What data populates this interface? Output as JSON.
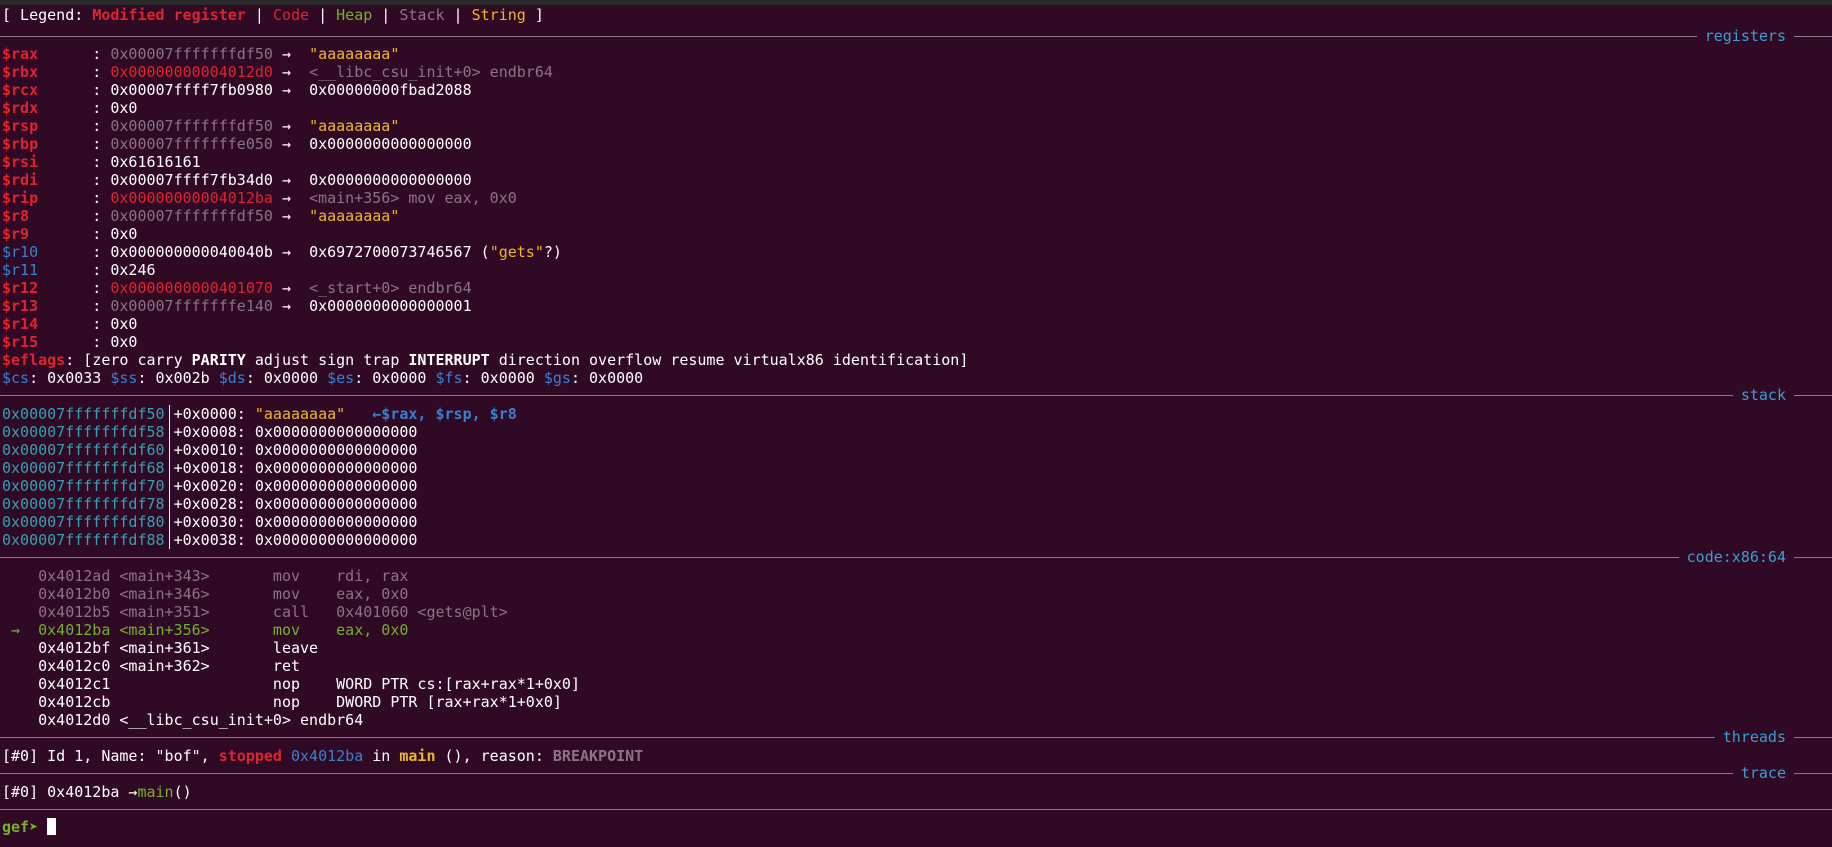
{
  "legend": {
    "open": "[ Legend: ",
    "modified": "Modified register",
    "sep": " | ",
    "code": "Code",
    "heap": "Heap",
    "stack": "Stack",
    "string": "String",
    "close": " ]"
  },
  "sections": {
    "registers": "registers",
    "stack": "stack",
    "code": "code:x86:64",
    "threads": "threads",
    "trace": "trace"
  },
  "arrow": " →  ",
  "registers": [
    {
      "name": "$rax   ",
      "value": "0x00007fffffffdf50",
      "deref": "\"aaaaaaaa\""
    },
    {
      "name": "$rbx   ",
      "value": "0x00000000004012d0",
      "deref": "<__libc_csu_init+0> endbr64"
    },
    {
      "name": "$rcx   ",
      "value": "0x00007ffff7fb0980",
      "deref": "0x00000000fbad2088"
    },
    {
      "name": "$rdx   ",
      "value": "0x0",
      "deref": ""
    },
    {
      "name": "$rsp   ",
      "value": "0x00007fffffffdf50",
      "deref": "\"aaaaaaaa\""
    },
    {
      "name": "$rbp   ",
      "value": "0x00007fffffffe050",
      "deref": "0x0000000000000000"
    },
    {
      "name": "$rsi   ",
      "value": "0x61616161",
      "deref": ""
    },
    {
      "name": "$rdi   ",
      "value": "0x00007ffff7fb34d0",
      "deref": "0x0000000000000000"
    },
    {
      "name": "$rip   ",
      "value": "0x00000000004012ba",
      "deref": "<main+356> mov eax, 0x0"
    },
    {
      "name": "$r8    ",
      "value": "0x00007fffffffdf50",
      "deref": "\"aaaaaaaa\""
    },
    {
      "name": "$r9    ",
      "value": "0x0",
      "deref": ""
    },
    {
      "name": "$r10   ",
      "value": "0x000000000040040b",
      "deref": "0x6972700073746567 (",
      "deref_str": "\"gets\"",
      "deref_tail": "?)"
    },
    {
      "name": "$r11   ",
      "value": "0x246",
      "deref": ""
    },
    {
      "name": "$r12   ",
      "value": "0x0000000000401070",
      "deref": "<_start+0> endbr64"
    },
    {
      "name": "$r13   ",
      "value": "0x00007fffffffe140",
      "deref": "0x0000000000000001"
    },
    {
      "name": "$r14   ",
      "value": "0x0",
      "deref": ""
    },
    {
      "name": "$r15   ",
      "value": "0x0",
      "deref": ""
    }
  ],
  "eflags": {
    "name": "$eflags",
    "open": ": [",
    "zero": "zero",
    "carry": "carry",
    "parity": "PARITY",
    "adjust": "adjust",
    "sign": "sign",
    "trap": "trap",
    "interrupt": "INTERRUPT",
    "direction": "direction",
    "overflow": "overflow",
    "resume": "resume",
    "virtualx86": "virtualx86",
    "identification": "identification",
    "close": "]"
  },
  "segments": {
    "cs": "$cs",
    "cs_v": ": 0x0033 ",
    "ss": "$ss",
    "ss_v": ": 0x002b ",
    "ds": "$ds",
    "ds_v": ": 0x0000 ",
    "es": "$es",
    "es_v": ": 0x0000 ",
    "fs": "$fs",
    "fs_v": ": 0x0000 ",
    "gs": "$gs",
    "gs_v": ": 0x0000"
  },
  "colon": "   : ",
  "stack": [
    {
      "addr": "0x00007fffffffdf50",
      "offset": "+0x0000: ",
      "value": "\"aaaaaaaa\"",
      "note": "   ←$rax, $rsp, $r8"
    },
    {
      "addr": "0x00007fffffffdf58",
      "offset": "+0x0008: ",
      "value": "0x0000000000000000",
      "note": ""
    },
    {
      "addr": "0x00007fffffffdf60",
      "offset": "+0x0010: ",
      "value": "0x0000000000000000",
      "note": ""
    },
    {
      "addr": "0x00007fffffffdf68",
      "offset": "+0x0018: ",
      "value": "0x0000000000000000",
      "note": ""
    },
    {
      "addr": "0x00007fffffffdf70",
      "offset": "+0x0020: ",
      "value": "0x0000000000000000",
      "note": ""
    },
    {
      "addr": "0x00007fffffffdf78",
      "offset": "+0x0028: ",
      "value": "0x0000000000000000",
      "note": ""
    },
    {
      "addr": "0x00007fffffffdf80",
      "offset": "+0x0030: ",
      "value": "0x0000000000000000",
      "note": ""
    },
    {
      "addr": "0x00007fffffffdf88",
      "offset": "+0x0038: ",
      "value": "0x0000000000000000",
      "note": ""
    }
  ],
  "code": [
    {
      "marker": "    ",
      "text": "0x4012ad <main+343>       mov    rdi, rax"
    },
    {
      "marker": "    ",
      "text": "0x4012b0 <main+346>       mov    eax, 0x0"
    },
    {
      "marker": "    ",
      "text": "0x4012b5 <main+351>       call   0x401060 <gets@plt>"
    },
    {
      "marker": " →  ",
      "text": "0x4012ba <main+356>       mov    eax, 0x0"
    },
    {
      "marker": "    ",
      "text": "0x4012bf <main+361>       leave"
    },
    {
      "marker": "    ",
      "text": "0x4012c0 <main+362>       ret"
    },
    {
      "marker": "    ",
      "text": "0x4012c1                  nop    WORD PTR cs:[rax+rax*1+0x0]"
    },
    {
      "marker": "    ",
      "text": "0x4012cb                  nop    DWORD PTR [rax+rax*1+0x0]"
    },
    {
      "marker": "    ",
      "text": "0x4012d0 <__libc_csu_init+0> endbr64"
    }
  ],
  "thread": {
    "id": "[#0]",
    "info": " Id 1, Name: \"bof\", ",
    "state": "stopped",
    "sp": " ",
    "addr": "0x4012ba",
    "in": " in ",
    "fn": "main",
    "reason_label": " (), reason: ",
    "reason": "BREAKPOINT"
  },
  "trace": {
    "id": "[#0]",
    "addr": " 0x4012ba →",
    "fn": "main",
    "call": "()"
  },
  "prompt": {
    "text": "gef➤ "
  },
  "colors": {
    "background": "#300a24",
    "modified": "#e0242f",
    "code": "#73b22a",
    "string": "#f0b62a",
    "section_title": "#3a9fd2"
  }
}
